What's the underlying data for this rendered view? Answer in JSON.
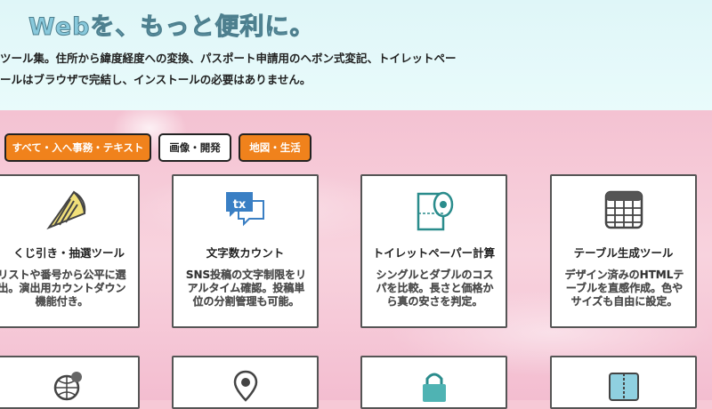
{
  "hero": {
    "title": "Webを、もっと便利に。",
    "line1": "ツール集。住所から緯度経度への変換、パスポート申請用のヘボン式変記、トイレットペー",
    "line2": "ールはブラウザで完結し、インストールの必要はありません。"
  },
  "tabs": [
    {
      "label": "すべて・入へ事務・テキスト"
    },
    {
      "label": "画像・開発"
    },
    {
      "label": "地図・生活"
    }
  ],
  "cards": [
    {
      "title": "くじ引き・抽選ツール",
      "desc": "リストや番号から公平に選出。演出用カウントダウン機能付き。",
      "icon": "lottery-cone-icon"
    },
    {
      "title": "文字数カウント",
      "desc": "SNS投稿の文字制限をリアルタイム確認。投稿単位の分割管理も可能。",
      "icon": "text-chat-icon"
    },
    {
      "title": "トイレットペーパー計算",
      "desc": "シングルとダブルのコスパを比較。長さと価格から真の安さを判定。",
      "icon": "toilet-paper-icon"
    },
    {
      "title": "テーブル生成ツール",
      "desc": "デザイン済みのHTMLテーブルを直感作成。色やサイズも自由に設定。",
      "icon": "table-grid-icon"
    }
  ],
  "bottom_cards": [
    {
      "icon": "globe-gear-icon"
    },
    {
      "icon": "map-pin-icon"
    },
    {
      "icon": "lock-bag-icon"
    },
    {
      "icon": "folder-zip-icon"
    }
  ],
  "colors": {
    "accent_orange": "#f0821c",
    "hero_bg": "#dff6f8",
    "sky_pink": "#f4c2d2",
    "icon_teal": "#2a8c8c"
  }
}
